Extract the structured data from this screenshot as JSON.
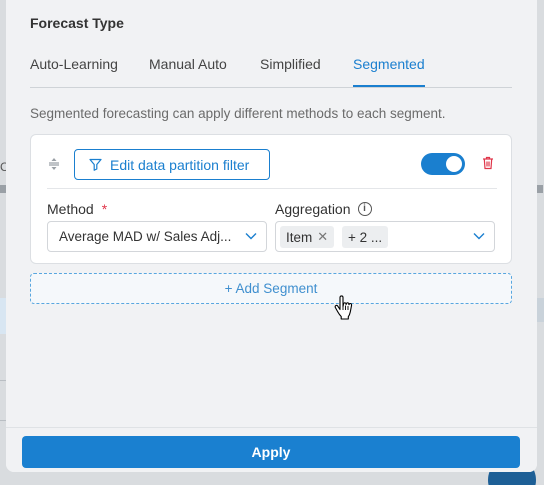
{
  "background": {
    "left_clip_letter": "C"
  },
  "dialog": {
    "title": "Forecast Type",
    "tabs": [
      {
        "label": "Auto-Learning",
        "active": false
      },
      {
        "label": "Manual Auto",
        "active": false
      },
      {
        "label": "Simplified",
        "active": false
      },
      {
        "label": "Segmented",
        "active": true
      }
    ],
    "description": "Segmented forecasting can apply different methods to each segment.",
    "segment": {
      "filter_button_label": "Edit data partition filter",
      "enabled": true,
      "method": {
        "label": "Method",
        "required_marker": "*",
        "value": "Average MAD w/ Sales Adj..."
      },
      "aggregation": {
        "label": "Aggregation",
        "info_icon": "i",
        "tags": [
          "Item",
          "+ 2 ..."
        ]
      }
    },
    "add_segment_label": "+ Add Segment",
    "apply_label": "Apply"
  },
  "colors": {
    "accent": "#1a7fcf",
    "danger": "#e0364a",
    "panel_bg": "#f1f2f4"
  }
}
